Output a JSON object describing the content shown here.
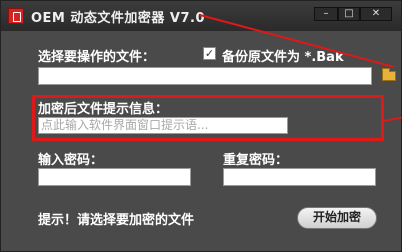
{
  "window": {
    "title": "OEM 动态文件加密器 V7.0",
    "minimize_glyph": "–",
    "maximize_glyph": "□",
    "close_glyph": "✕"
  },
  "file_section": {
    "label": "选择要操作的文件：",
    "file_value": "",
    "backup_checked": true,
    "backup_label": "备份原文件为 *.Bak"
  },
  "hint_section": {
    "label": "加密后文件提示信息：",
    "placeholder": "点此输入软件界面窗口提示语..."
  },
  "password_section": {
    "password_label": "输入密码：",
    "confirm_label": "重复密码：",
    "password_value": "",
    "confirm_value": ""
  },
  "status": {
    "text": "提示！请选择要加密的文件"
  },
  "actions": {
    "start_label": "开始加密"
  },
  "colors": {
    "window_bg": "#4a4a4a",
    "highlight": "#e01818"
  }
}
